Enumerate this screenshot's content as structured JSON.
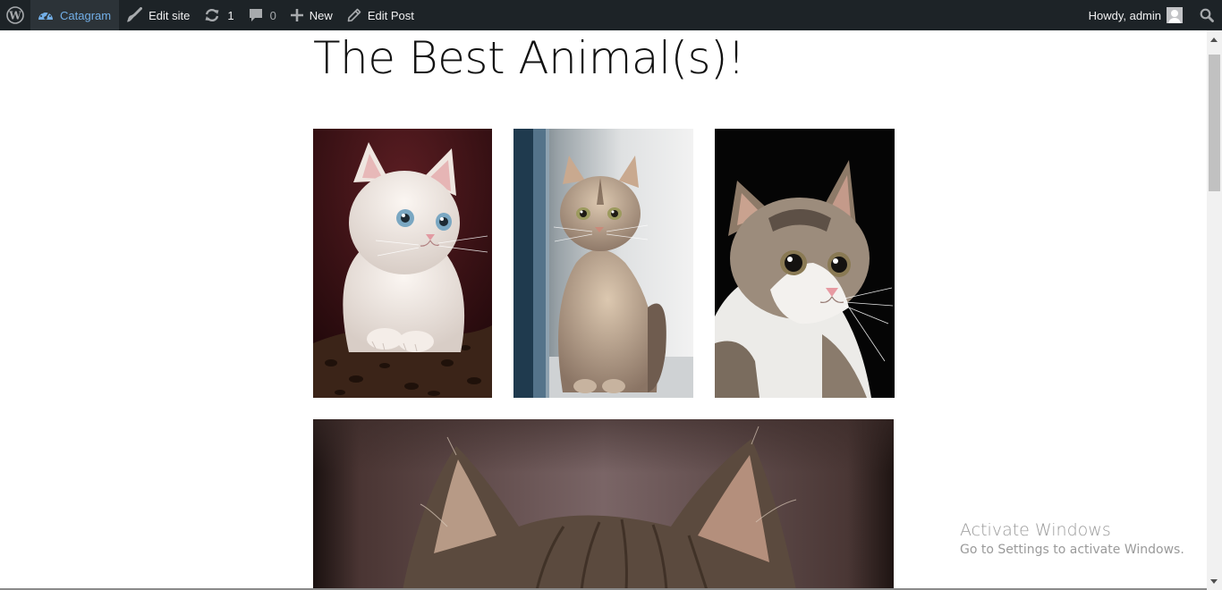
{
  "admin_bar": {
    "site_name": "Catagram",
    "edit_site_label": "Edit site",
    "updates_count": "1",
    "comments_count": "0",
    "new_label": "New",
    "edit_post_label": "Edit Post",
    "greeting": "Howdy, admin",
    "icons": [
      "wordpress-logo-icon",
      "dashboard-icon",
      "brush-icon",
      "updates-icon",
      "comment-icon",
      "plus-icon",
      "pencil-icon",
      "avatar",
      "search-icon"
    ],
    "colors": {
      "background": "#1d2327",
      "site_active_bg": "#2c3338",
      "site_active_text": "#72aee6"
    }
  },
  "post": {
    "title": "The Best Animal(s)!",
    "gallery": [
      {
        "alt": "white kitten"
      },
      {
        "alt": "fluffy kitten sitting"
      },
      {
        "alt": "tabby and white cat"
      },
      {
        "alt": "cat ears close-up"
      }
    ]
  },
  "watermark": {
    "line1": "Activate Windows",
    "line2": "Go to Settings to activate Windows."
  }
}
